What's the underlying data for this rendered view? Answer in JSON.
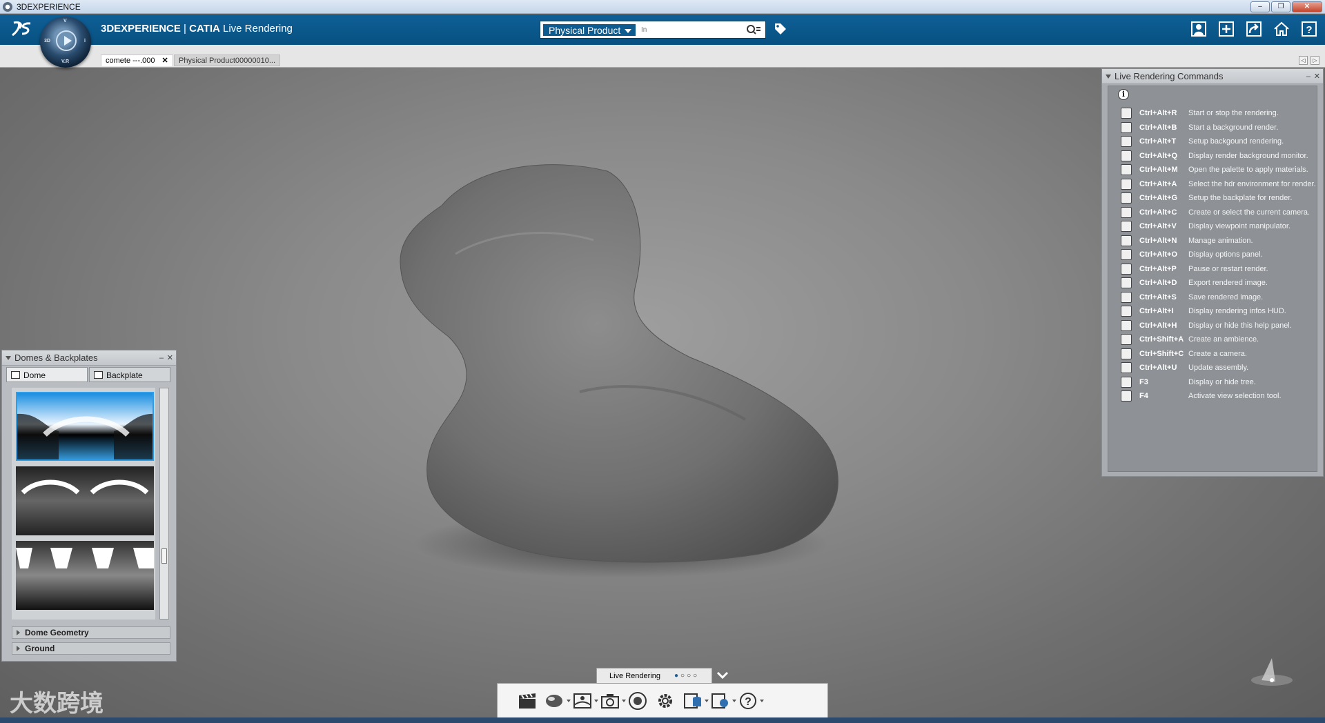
{
  "window": {
    "title": "3DEXPERIENCE",
    "buttons": [
      "–",
      "❐",
      "✕"
    ]
  },
  "header": {
    "brand": "3DEXPERIENCE",
    "separator": " | ",
    "product": "CATIA",
    "app": "Live Rendering",
    "compass_labels": {
      "top": "V",
      "left": "3D",
      "bottom": "V.R",
      "right": "i"
    },
    "search": {
      "scope": "Physical Product",
      "placeholder": "In"
    }
  },
  "tabs": [
    {
      "label": "comete ---.000",
      "close": "✕"
    },
    {
      "label": "Physical Product00000010..."
    }
  ],
  "tab_nav": [
    "◁",
    "▷"
  ],
  "commands_panel": {
    "title": "Live Rendering Commands",
    "controls": [
      "–",
      "✕"
    ],
    "info": "i",
    "rows": [
      {
        "key": "Ctrl+Alt+R",
        "desc": "Start or stop the rendering.",
        "icon": "clapperboard-icon"
      },
      {
        "key": "Ctrl+Alt+B",
        "desc": "Start a background render.",
        "icon": "background-render-icon"
      },
      {
        "key": "Ctrl+Alt+T",
        "desc": "Setup backgound rendering.",
        "icon": "render-setup-icon"
      },
      {
        "key": "Ctrl+Alt+Q",
        "desc": "Display render background monitor.",
        "icon": "monitor-icon"
      },
      {
        "key": "Ctrl+Alt+M",
        "desc": "Open the palette to apply materials.",
        "icon": "material-sphere-icon"
      },
      {
        "key": "Ctrl+Alt+A",
        "desc": "Select the hdr environment for render.",
        "icon": "hdr-environment-icon"
      },
      {
        "key": "Ctrl+Alt+G",
        "desc": "Setup the backplate for render.",
        "icon": "backplate-icon"
      },
      {
        "key": "Ctrl+Alt+C",
        "desc": "Create or select the current camera.",
        "icon": "camera-icon"
      },
      {
        "key": "Ctrl+Alt+V",
        "desc": "Display viewpoint manipulator.",
        "icon": "viewpoint-icon"
      },
      {
        "key": "Ctrl+Alt+N",
        "desc": "Manage animation.",
        "icon": "animation-icon"
      },
      {
        "key": "Ctrl+Alt+O",
        "desc": "Display options panel.",
        "icon": "gear-icon"
      },
      {
        "key": "Ctrl+Alt+P",
        "desc": "Pause or restart render.",
        "icon": "pause-icon"
      },
      {
        "key": "Ctrl+Alt+D",
        "desc": "Export rendered image.",
        "icon": "export-image-icon"
      },
      {
        "key": "Ctrl+Alt+S",
        "desc": "Save rendered image.",
        "icon": "save-image-icon"
      },
      {
        "key": "Ctrl+Alt+I",
        "desc": "Display rendering infos HUD.",
        "icon": "info-hud-icon"
      },
      {
        "key": "Ctrl+Alt+H",
        "desc": "Display or hide this help panel.",
        "icon": "help-icon"
      },
      {
        "key": "Ctrl+Shift+A",
        "desc": "Create an ambience.",
        "icon": "ambience-icon"
      },
      {
        "key": "Ctrl+Shift+C",
        "desc": "Create a camera.",
        "icon": "create-camera-icon"
      },
      {
        "key": "Ctrl+Alt+U",
        "desc": "Update assembly.",
        "icon": "update-icon"
      },
      {
        "key": "F3",
        "desc": "Display or hide tree.",
        "icon": "tree-icon"
      },
      {
        "key": "F4",
        "desc": "Activate view selection tool.",
        "icon": "eye-icon"
      }
    ]
  },
  "domes_panel": {
    "title": "Domes & Backplates",
    "controls": [
      "–",
      "✕"
    ],
    "tabs": [
      "Dome",
      "Backplate"
    ],
    "sections": [
      "Dome Geometry",
      "Ground"
    ]
  },
  "action_bar": {
    "tab_label": "Live Rendering",
    "pages": [
      "●",
      "○",
      "○",
      "○"
    ],
    "icons": [
      "clapperboard-icon",
      "material-sphere-icon",
      "environment-icon",
      "camera-icon",
      "viewpoint-icon",
      "gear-icon",
      "database-icon",
      "options-icon",
      "help-icon"
    ]
  },
  "watermark": "大数跨境",
  "colors": {
    "header_blue": "#075181",
    "panel_gray": "#8e9297",
    "selected_blue": "#2f9ee8"
  }
}
